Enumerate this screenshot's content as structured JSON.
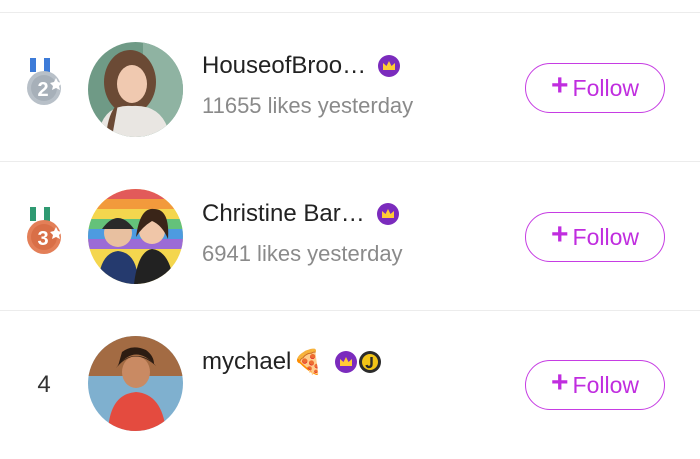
{
  "rows": [
    {
      "rank_display": "2",
      "name": "HouseofBroo…",
      "name_emoji": "",
      "subtitle": "11655 likes yesterday",
      "badges": [
        "crown-icon"
      ],
      "follow_label": "Follow",
      "follow_plus": "+"
    },
    {
      "rank_display": "3",
      "name": "Christine Bar…",
      "name_emoji": "",
      "subtitle": "6941 likes yesterday",
      "badges": [
        "crown-icon"
      ],
      "follow_label": "Follow",
      "follow_plus": "+"
    },
    {
      "rank_display": "4",
      "name": "mychael",
      "name_emoji": "🍕",
      "subtitle": "",
      "badges": [
        "crown-icon",
        "j-badge-icon"
      ],
      "follow_label": "Follow",
      "follow_plus": "+"
    }
  ],
  "colors": {
    "accent": "#c02ddf",
    "silver": "#b8c0c8",
    "bronze": "#e37f58",
    "ribbon_blue": "#3d7bd8",
    "ribbon_green": "#2f9a72",
    "crown_bg": "#7b2bbd",
    "crown_gold": "#ffcc33",
    "subtitle_gray": "#8a8a8a"
  }
}
